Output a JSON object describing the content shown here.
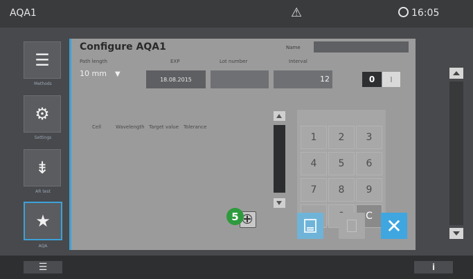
{
  "topbar": {
    "title": "AQA1",
    "warning_icon": "warning-icon",
    "time": "16:05"
  },
  "sidebar": {
    "items": [
      {
        "label": "Methods",
        "icon": "methods-icon"
      },
      {
        "label": "Settings",
        "icon": "settings-icon"
      },
      {
        "label": "AR test",
        "icon": "ar-test-icon"
      },
      {
        "label": "AQA",
        "icon": "aqa-icon"
      }
    ]
  },
  "dialog": {
    "title": "Configure AQA1",
    "name_label": "Name",
    "name_value": "",
    "path_length_label": "Path length",
    "path_length_value": "10 mm",
    "exp_label": "EXP",
    "exp_value": "18.08.2015",
    "lot_label": "Lot number",
    "lot_value": "",
    "interval_label": "Interval",
    "interval_value": "12",
    "toggle_off": "0",
    "toggle_on": "I",
    "columns": [
      "Cell",
      "Wavelength",
      "Target value",
      "Tolerance"
    ],
    "keypad": [
      "1",
      "2",
      "3",
      "4",
      "5",
      "6",
      "7",
      "8",
      "9",
      "",
      "0",
      "C"
    ],
    "callout_badge": "5"
  },
  "colors": {
    "accent": "#3da2d8",
    "badge": "#2e9a3e",
    "close_button": "#3fa6e0"
  },
  "bottombar": {
    "menu_glyph": "☰",
    "info_glyph": "i"
  }
}
